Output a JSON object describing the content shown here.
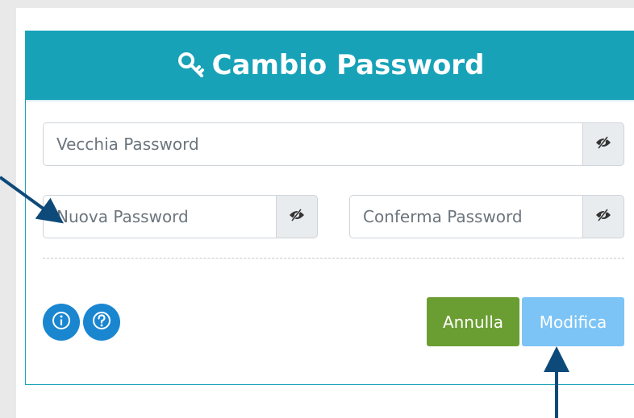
{
  "header": {
    "title": "Cambio Password",
    "icon": "key-icon",
    "color": "#17a2b8"
  },
  "form": {
    "old_password": {
      "placeholder": "Vecchia Password",
      "value": ""
    },
    "new_password": {
      "placeholder": "Nuova Password",
      "value": ""
    },
    "confirm_password": {
      "placeholder": "Conferma Password",
      "value": ""
    },
    "toggle_icon": "eye-slash-icon"
  },
  "actions": {
    "info_icon": "info-icon",
    "help_icon": "question-icon",
    "cancel_label": "Annulla",
    "cancel_color": "#6b9e32",
    "modify_label": "Modifica",
    "modify_color": "#7cc4f5"
  },
  "annotations": {
    "arrow_color": "#0d4a7a"
  }
}
